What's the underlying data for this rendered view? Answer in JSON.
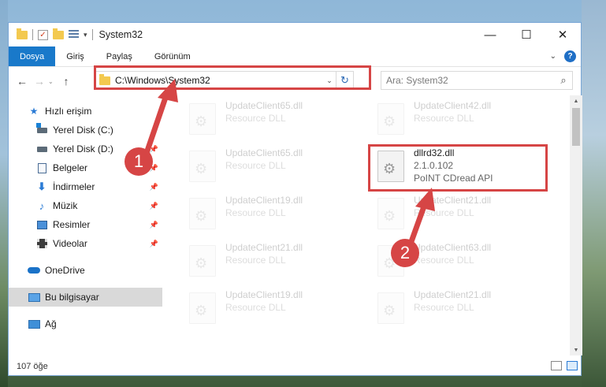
{
  "window": {
    "title": "System32",
    "controls": {
      "minimize": "—",
      "maximize": "☐",
      "close": "✕"
    }
  },
  "ribbon": {
    "tabs": [
      "Dosya",
      "Giriş",
      "Paylaş",
      "Görünüm"
    ],
    "help": "?"
  },
  "address": {
    "path": "C:\\Windows\\System32"
  },
  "search": {
    "placeholder": "Ara: System32"
  },
  "sidebar": {
    "items": [
      {
        "label": "Hızlı erişim",
        "icon": "star-icon"
      },
      {
        "label": "Yerel Disk (C:)",
        "icon": "drive-c-icon"
      },
      {
        "label": "Yerel Disk (D:)",
        "icon": "drive-d-icon"
      },
      {
        "label": "Belgeler",
        "icon": "documents-icon"
      },
      {
        "label": "İndirmeler",
        "icon": "downloads-icon"
      },
      {
        "label": "Müzik",
        "icon": "music-icon"
      },
      {
        "label": "Resimler",
        "icon": "pictures-icon"
      },
      {
        "label": "Videolar",
        "icon": "videos-icon"
      },
      {
        "label": "OneDrive",
        "icon": "onedrive-icon"
      },
      {
        "label": "Bu bilgisayar",
        "icon": "this-pc-icon"
      },
      {
        "label": "Ağ",
        "icon": "network-icon"
      }
    ]
  },
  "files": [
    {
      "name": "UpdateClient65.dll",
      "line2": "Resource DLL",
      "line3": ""
    },
    {
      "name": "UpdateClient42.dll",
      "line2": "Resource DLL",
      "line3": ""
    },
    {
      "name": "UpdateClient65.dll",
      "line2": "Resource DLL",
      "line3": ""
    },
    {
      "name": "dllrd32.dll",
      "line2": "2.1.0.102",
      "line3": "PoINT CDread API"
    },
    {
      "name": "UpdateClient19.dll",
      "line2": "Resource DLL",
      "line3": ""
    },
    {
      "name": "UpdateClient21.dll",
      "line2": "Resource DLL",
      "line3": ""
    },
    {
      "name": "UpdateClient21.dll",
      "line2": "Resource DLL",
      "line3": ""
    },
    {
      "name": "UpdateClient63.dll",
      "line2": "Resource DLL",
      "line3": ""
    },
    {
      "name": "UpdateClient19.dll",
      "line2": "Resource DLL",
      "line3": ""
    },
    {
      "name": "UpdateClient21.dll",
      "line2": "Resource DLL",
      "line3": ""
    }
  ],
  "status": {
    "count": "107 öğe"
  },
  "annotations": {
    "step1": "1",
    "step2": "2",
    "color": "#d64545"
  }
}
